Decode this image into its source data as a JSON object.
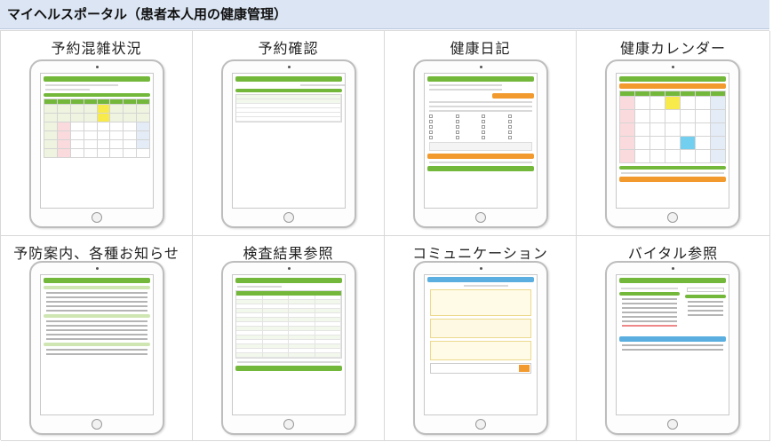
{
  "header": {
    "title": "マイヘルスポータル（患者本人用の健康管理）"
  },
  "panels": [
    {
      "title": "予約混雑状況"
    },
    {
      "title": "予約確認"
    },
    {
      "title": "健康日記"
    },
    {
      "title": "健康カレンダー"
    },
    {
      "title": "予防案内、各種お知らせ"
    },
    {
      "title": "検査結果参照"
    },
    {
      "title": "コミュニケーション"
    },
    {
      "title": "バイタル参照"
    }
  ],
  "colors": {
    "header_bg": "#dbe5f3",
    "accent_green": "#74b83b",
    "accent_orange": "#f29a2e",
    "highlight_yellow": "#f8ea4a",
    "accent_blue": "#5aaee0"
  }
}
